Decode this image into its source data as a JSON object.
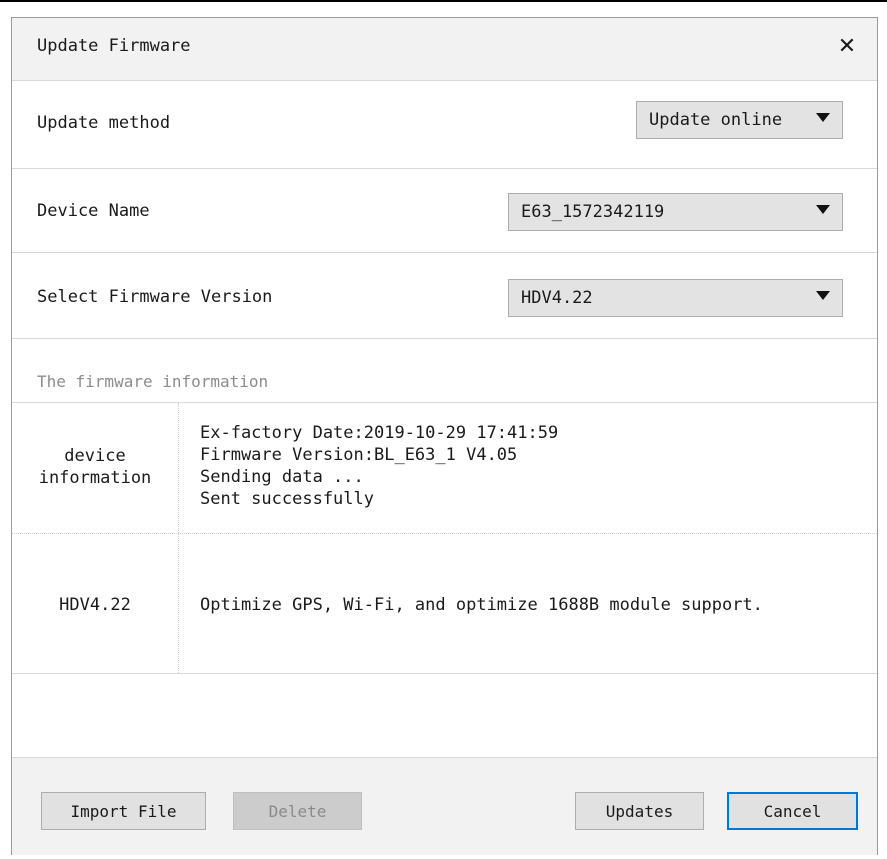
{
  "dialog": {
    "title": "Update Firmware",
    "close_glyph": "✕"
  },
  "form": {
    "update_method": {
      "label": "Update method",
      "value": "Update online"
    },
    "device_name": {
      "label": "Device Name",
      "value": "E63_1572342119"
    },
    "firmware_version": {
      "label": "Select Firmware Version",
      "value": "HDV4.22"
    }
  },
  "firmware_info": {
    "section_label": "The firmware information",
    "rows": [
      {
        "key_lines": [
          "device",
          "information"
        ],
        "value_lines": [
          "Ex-factory Date:2019-10-29 17:41:59",
          "Firmware Version:BL_E63_1 V4.05",
          "Sending data ...",
          "Sent successfully"
        ]
      },
      {
        "key_lines": [
          "HDV4.22"
        ],
        "value_lines": [
          "Optimize GPS, Wi-Fi, and optimize 1688B module support."
        ]
      }
    ]
  },
  "footer": {
    "import_label": "Import File",
    "delete_label": "Delete",
    "updates_label": "Updates",
    "cancel_label": "Cancel"
  },
  "icons": {
    "close": "close-icon",
    "dropdown": "chevron-down-icon"
  },
  "colors": {
    "focus_border": "#0078d7",
    "select_bg": "#e3e3e3",
    "title_bg": "#f2f2f2"
  }
}
